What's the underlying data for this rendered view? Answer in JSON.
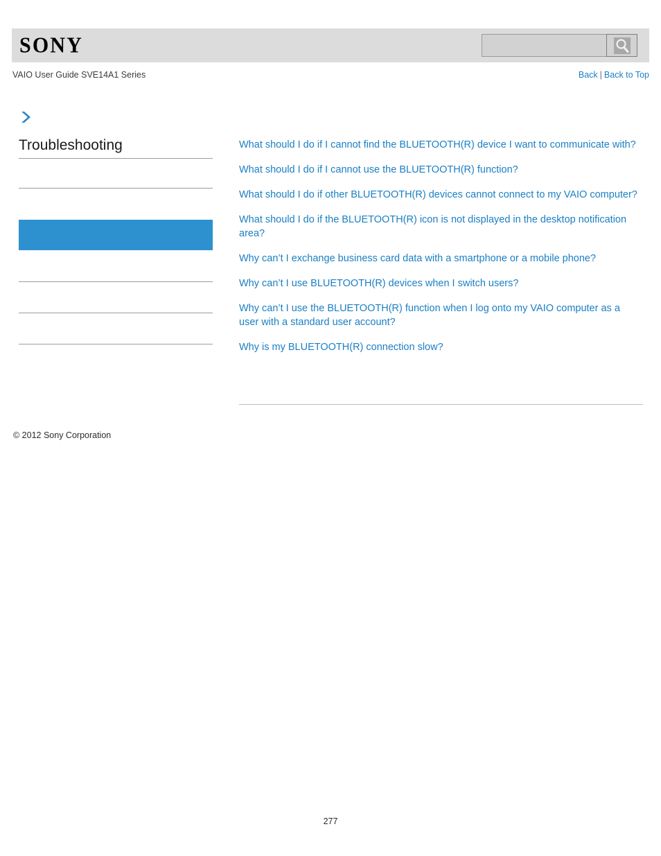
{
  "header": {
    "logo_text": "SONY",
    "search": {
      "value": "",
      "placeholder": "",
      "button_icon": "search-icon"
    }
  },
  "subtitle_bar": {
    "guide_title": "VAIO User Guide SVE14A1 Series",
    "back_label": "Back",
    "separator": "|",
    "back_to_top_label": "Back to Top"
  },
  "sidebar": {
    "chevron_icon": "chevron-right-icon",
    "section_title": "Troubleshooting",
    "items": [
      {
        "label": "",
        "selected": false
      },
      {
        "label": "",
        "selected": false
      },
      {
        "label": "",
        "selected": true
      },
      {
        "label": "",
        "selected": false
      },
      {
        "label": "",
        "selected": false
      }
    ]
  },
  "content": {
    "links": [
      "What should I do if I cannot find the BLUETOOTH(R) device I want to communicate with?",
      "What should I do if I cannot use the BLUETOOTH(R) function?",
      "What should I do if other BLUETOOTH(R) devices cannot connect to my VAIO computer?",
      "What should I do if the BLUETOOTH(R) icon is not displayed in the desktop notification area?",
      "Why can’t I exchange business card data with a smartphone or a mobile phone?",
      "Why can’t I use BLUETOOTH(R) devices when I switch users?",
      "Why can’t I use the BLUETOOTH(R) function when I log onto my VAIO computer as a user with a standard user account?",
      "Why is my BLUETOOTH(R) connection slow?"
    ]
  },
  "footer": {
    "copyright": "© 2012 Sony Corporation",
    "page_number": "277"
  },
  "colors": {
    "link_blue": "#1b7fc4",
    "highlight_blue": "#2e91cf",
    "header_band_gray": "#dcdcdc",
    "rule_gray": "#9b9b9b"
  }
}
